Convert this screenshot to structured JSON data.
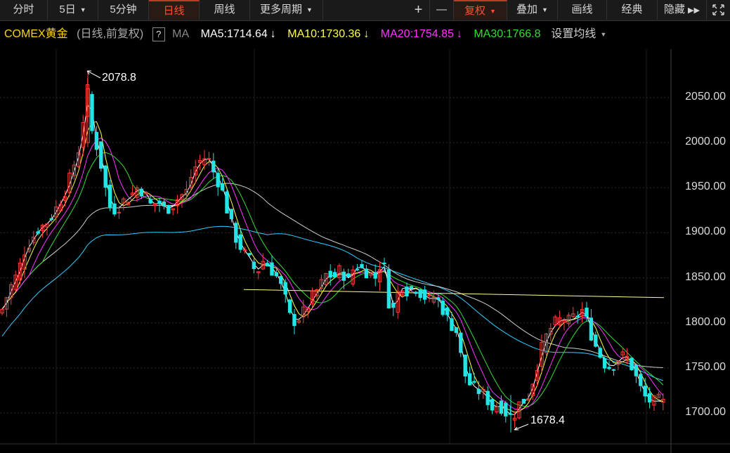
{
  "toolbar": {
    "fenshi": "分时",
    "five_day": "5日",
    "five_min": "5分钟",
    "daily": "日线",
    "weekly": "周线",
    "more_period": "更多周期",
    "plus": "+",
    "minus": "—",
    "fuquan": "复权",
    "overlay": "叠加",
    "draw": "画线",
    "classic": "经典",
    "hide": "隐藏"
  },
  "legend": {
    "symbol": "COMEX黄金",
    "mode": "(日线,前复权)",
    "help": "?",
    "ma_label": "MA",
    "ma5": "MA5:1714.64",
    "ma10": "MA10:1730.36",
    "ma20": "MA20:1754.85",
    "ma30": "MA30:1766.8",
    "arrow": "↓",
    "settings": "设置均线"
  },
  "colors": {
    "up": "#ff3b3b",
    "down": "#22e6e6",
    "ma5": "#ffffff",
    "ma10": "#ffff44",
    "ma20": "#ff33ff",
    "ma30": "#33dd33",
    "ma_long": "#cccccc",
    "ma_longer": "#33ccff",
    "support": "#ffff88"
  },
  "axis": {
    "ticks": [
      "2050.00",
      "2000.00",
      "1950.00",
      "1900.00",
      "1850.00",
      "1800.00",
      "1750.00",
      "1700.00"
    ],
    "high_label": "2078.8",
    "low_label": "1678.4"
  },
  "chart_data": {
    "type": "candlestick",
    "instrument": "COMEX黄金",
    "y_ticks": [
      2050,
      2000,
      1950,
      1900,
      1850,
      1800,
      1750,
      1700
    ],
    "high": 2078.8,
    "low": 1678.4,
    "grid": true
  }
}
